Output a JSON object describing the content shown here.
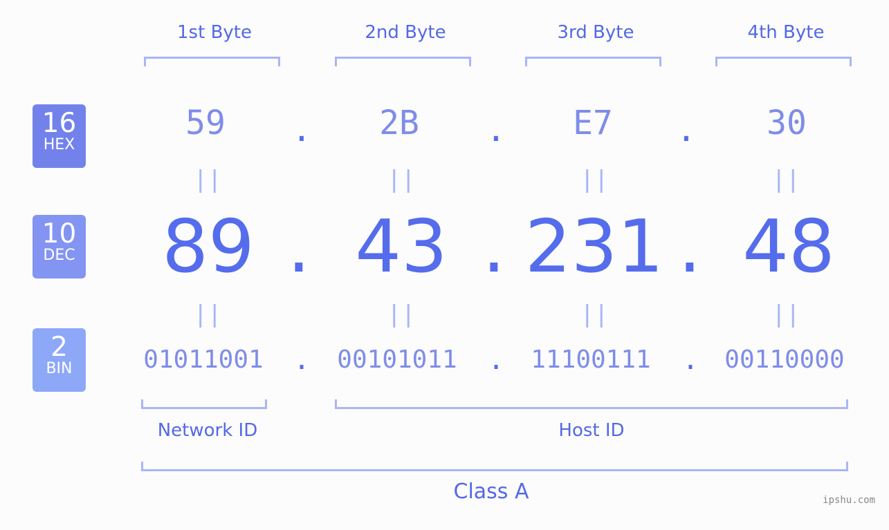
{
  "bytes": [
    {
      "label": "1st Byte",
      "hex": "59",
      "dec": "89",
      "bin": "01011001"
    },
    {
      "label": "2nd Byte",
      "hex": "2B",
      "dec": "43",
      "bin": "00101011"
    },
    {
      "label": "3rd Byte",
      "hex": "E7",
      "dec": "231",
      "bin": "11100111"
    },
    {
      "label": "4th Byte",
      "hex": "30",
      "dec": "48",
      "bin": "00110000"
    }
  ],
  "separator": ".",
  "equals": "||",
  "bases": {
    "hex": {
      "num": "16",
      "label": "HEX",
      "color": "#7382ea"
    },
    "dec": {
      "num": "10",
      "label": "DEC",
      "color": "#8394f2"
    },
    "bin": {
      "num": "2",
      "label": "BIN",
      "color": "#8ea8f8"
    }
  },
  "segments": {
    "network": "Network ID",
    "host": "Host ID",
    "class": "Class A"
  },
  "watermark": "ipshu.com"
}
